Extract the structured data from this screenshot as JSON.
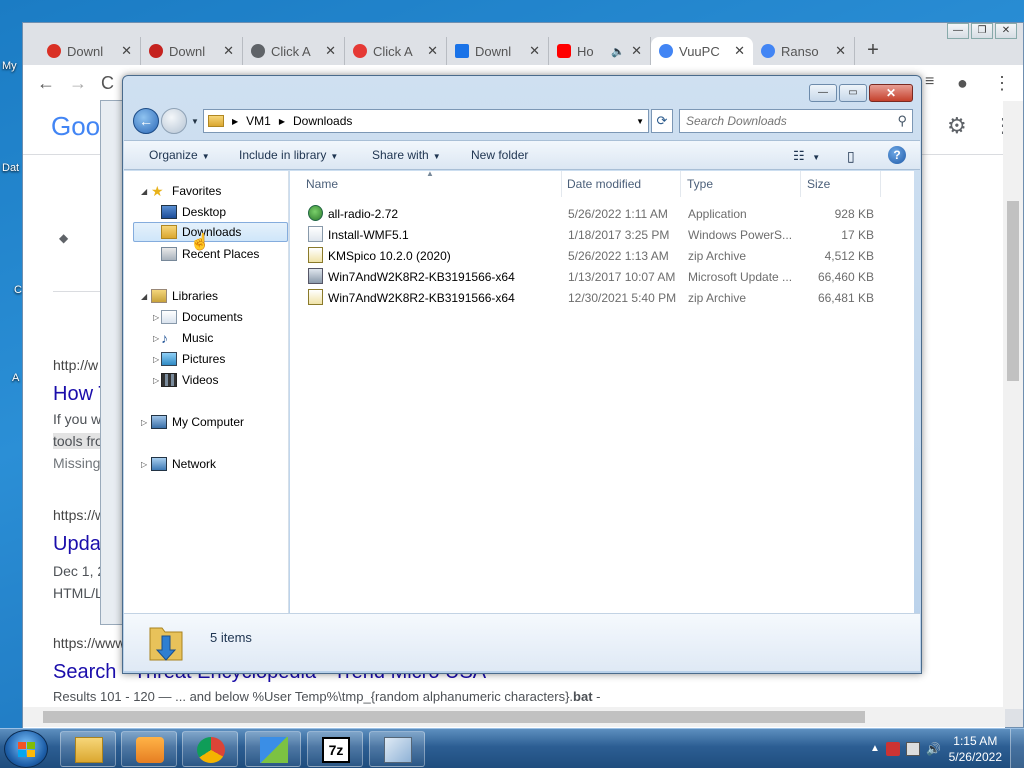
{
  "desktop": {
    "labels": [
      "My",
      "Dat",
      "C",
      "A"
    ]
  },
  "chrome": {
    "tabs": [
      {
        "label": "Downl",
        "color": "#d93025"
      },
      {
        "label": "Downl",
        "color": "#c5221f"
      },
      {
        "label": "Click A",
        "color": "#5f6368"
      },
      {
        "label": "Click A",
        "color": "#e53935"
      },
      {
        "label": "Downl",
        "color": "#1a73e8"
      },
      {
        "label": "Ho",
        "color": "#ff0000"
      },
      {
        "label": "VuuPC",
        "color": "#4285f4"
      },
      {
        "label": "Ranso",
        "color": "#4285f4"
      }
    ],
    "page": {
      "logo": "Goo",
      "url1": "http://w",
      "link1": "How T",
      "snippet1a": "If you w",
      "snippet1b": "tools fro",
      "snippet1c": "Missing",
      "url2": "https://w",
      "link2": "Upda",
      "snippet2a": "Dec 1, 2",
      "snippet2b": "HTML/L",
      "url3": "https://www",
      "link3": "Search - Threat Encyclopedia - Trend Micro USA",
      "snippet3_pre": "Results 101 - 120 — ... and below %User Temp%\\tmp_{random alphanumeric characters}.",
      "snippet3_bold": "bat",
      "snippet3_post": " -"
    }
  },
  "explorer": {
    "breadcrumb": [
      "VM1",
      "Downloads"
    ],
    "search_placeholder": "Search Downloads",
    "commands": {
      "organize": "Organize",
      "include": "Include in library",
      "share": "Share with",
      "new_folder": "New folder"
    },
    "nav": {
      "favorites": "Favorites",
      "desktop": "Desktop",
      "downloads": "Downloads",
      "recent": "Recent Places",
      "libraries": "Libraries",
      "documents": "Documents",
      "music": "Music",
      "pictures": "Pictures",
      "videos": "Videos",
      "computer": "My Computer",
      "network": "Network"
    },
    "columns": {
      "name": "Name",
      "date": "Date modified",
      "type": "Type",
      "size": "Size"
    },
    "files": [
      {
        "name": "all-radio-2.72",
        "date": "5/26/2022 1:11 AM",
        "type": "Application",
        "size": "928 KB",
        "icon": "application-icon"
      },
      {
        "name": "Install-WMF5.1",
        "date": "1/18/2017 3:25 PM",
        "type": "Windows PowerS...",
        "size": "17 KB",
        "icon": "powershell-script-icon"
      },
      {
        "name": "KMSpico 10.2.0 (2020)",
        "date": "5/26/2022 1:13 AM",
        "type": "zip Archive",
        "size": "4,512 KB",
        "icon": "zip-icon"
      },
      {
        "name": "Win7AndW2K8R2-KB3191566-x64",
        "date": "1/13/2017 10:07 AM",
        "type": "Microsoft Update ...",
        "size": "66,460 KB",
        "icon": "msu-icon"
      },
      {
        "name": "Win7AndW2K8R2-KB3191566-x64",
        "date": "12/30/2021 5:40 PM",
        "type": "zip Archive",
        "size": "66,481 KB",
        "icon": "zip-icon"
      }
    ],
    "status": "5 items"
  },
  "taskbar": {
    "time": "1:15 AM",
    "date": "5/26/2022"
  }
}
